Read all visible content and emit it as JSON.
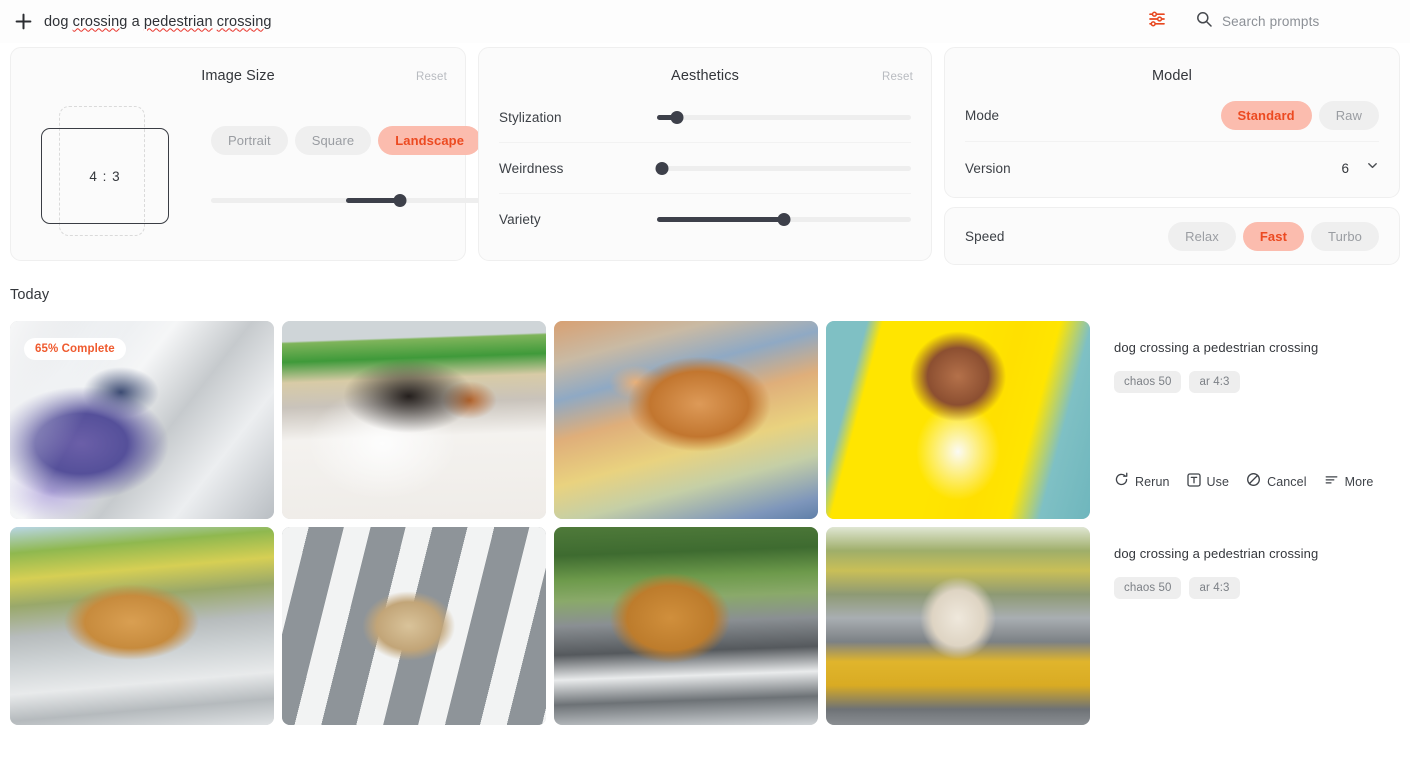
{
  "header": {
    "add_icon": "plus-icon",
    "prompt_value": "dog crossing a pedestrian crossing",
    "prompt_words": [
      "dog",
      "crossing",
      "a",
      "pedestrian",
      "crossing"
    ],
    "adjust_icon": "sliders-icon",
    "search_icon": "search-icon",
    "search_placeholder": "Search prompts"
  },
  "image_size": {
    "title": "Image Size",
    "reset_label": "Reset",
    "ratio_label": "4 : 3",
    "options": [
      "Portrait",
      "Square",
      "Landscape"
    ],
    "selected": "Landscape",
    "slider": {
      "name": "size-slider",
      "value": 70,
      "fill_start": 50
    }
  },
  "aesthetics": {
    "title": "Aesthetics",
    "reset_label": "Reset",
    "rows": [
      {
        "label": "Stylization",
        "value": 8,
        "fill_start": 0
      },
      {
        "label": "Weirdness",
        "value": 2,
        "fill_start": 0
      },
      {
        "label": "Variety",
        "value": 50,
        "fill_start": 0
      }
    ]
  },
  "model": {
    "title": "Model",
    "mode_label": "Mode",
    "mode_options": [
      "Standard",
      "Raw"
    ],
    "mode_selected": "Standard",
    "version_label": "Version",
    "version_value": "6",
    "version_chevron": "chevron-down-icon",
    "speed_label": "Speed",
    "speed_options": [
      "Relax",
      "Fast",
      "Turbo"
    ],
    "speed_selected": "Fast"
  },
  "gallery": {
    "section_label": "Today",
    "jobs": [
      {
        "prompt": "dog crossing a pedestrian crossing",
        "chips": [
          "chaos 50",
          "ar 4:3"
        ],
        "badge": "65% Complete",
        "badge_on_index": 0,
        "show_actions": true,
        "actions": [
          {
            "label": "Rerun",
            "icon": "rerun-icon"
          },
          {
            "label": "Use",
            "icon": "text-box-icon"
          },
          {
            "label": "Cancel",
            "icon": "cancel-icon"
          },
          {
            "label": "More",
            "icon": "more-lines-icon"
          }
        ],
        "images": [
          "art-a",
          "art-b",
          "art-c",
          "art-d"
        ]
      },
      {
        "prompt": "dog crossing a pedestrian crossing",
        "chips": [
          "chaos 50",
          "ar 4:3"
        ],
        "badge": null,
        "show_actions": false,
        "actions": [],
        "images": [
          "art-e",
          "art-f",
          "art-g",
          "art-h"
        ]
      }
    ]
  },
  "colors": {
    "accent": "#ec4a21",
    "accent_soft_bg": "#fbbcae",
    "badge_text": "#ef5a2e",
    "slider_dark": "#3d404a",
    "panel_bg": "#fbfbfb",
    "chip_bg": "#eeeeee"
  }
}
